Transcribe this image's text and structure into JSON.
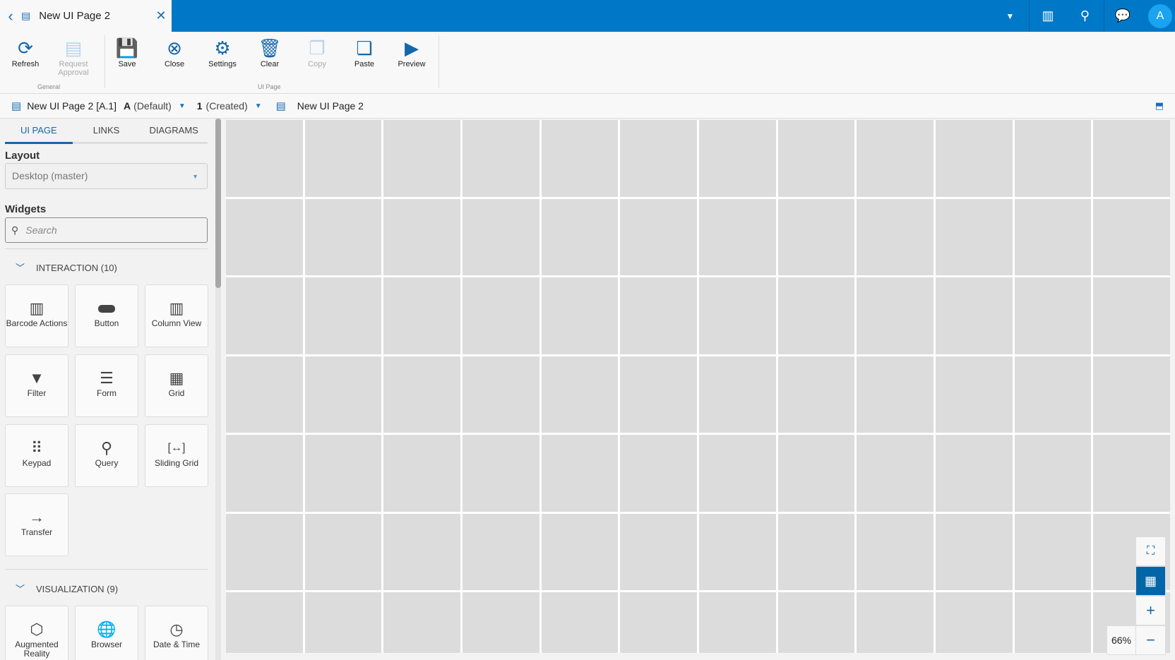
{
  "tab": {
    "title": "New UI Page 2"
  },
  "ribbon": {
    "general": [
      {
        "label": "Refresh",
        "enabled": true
      },
      {
        "label": "Request Approval",
        "enabled": false
      }
    ],
    "general_group": "General",
    "uipage": [
      {
        "label": "Save",
        "enabled": true
      },
      {
        "label": "Close",
        "enabled": true
      },
      {
        "label": "Settings",
        "enabled": true
      },
      {
        "label": "Clear",
        "enabled": true
      },
      {
        "label": "Copy",
        "enabled": false
      },
      {
        "label": "Paste",
        "enabled": true
      },
      {
        "label": "Preview",
        "enabled": true
      }
    ],
    "uipage_group": "UI Page"
  },
  "breadcrumb": {
    "page": "New UI Page 2 [A.1]",
    "rev_letter": "A",
    "rev_label": "(Default)",
    "ver_num": "1",
    "ver_label": "(Created)",
    "name": "New UI Page 2"
  },
  "user": {
    "initial": "A"
  },
  "panel": {
    "tabs": [
      "UI PAGE",
      "LINKS",
      "DIAGRAMS"
    ],
    "layout_label": "Layout",
    "layout_value": "Desktop (master)",
    "widgets_label": "Widgets",
    "search_placeholder": "Search",
    "interaction": {
      "title": "INTERACTION (10)",
      "items": [
        "Barcode Actions",
        "Button",
        "Column View",
        "Filter",
        "Form",
        "Grid",
        "Keypad",
        "Query",
        "Sliding Grid",
        "Transfer"
      ]
    },
    "visualization": {
      "title": "VISUALIZATION (9)",
      "items": [
        "Augmented Reality",
        "Browser",
        "Date & Time"
      ]
    }
  },
  "zoom": {
    "level": "66%"
  }
}
